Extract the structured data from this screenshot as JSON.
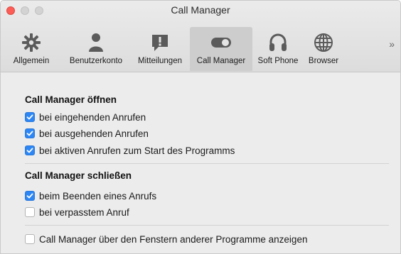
{
  "window": {
    "title": "Call Manager"
  },
  "toolbar": {
    "tabs": [
      {
        "label": "Allgemein",
        "icon": "gear-icon"
      },
      {
        "label": "Benutzerkonto",
        "icon": "user-icon"
      },
      {
        "label": "Mitteilungen",
        "icon": "notification-icon"
      },
      {
        "label": "Call Manager",
        "icon": "toggle-icon",
        "active": true
      },
      {
        "label": "Soft Phone",
        "icon": "headset-icon"
      },
      {
        "label": "Browser",
        "icon": "globe-icon"
      }
    ],
    "more_label": "»"
  },
  "open_section": {
    "title": "Call Manager öffnen",
    "options": [
      {
        "label": "bei eingehenden Anrufen",
        "checked": true
      },
      {
        "label": "bei ausgehenden Anrufen",
        "checked": true
      },
      {
        "label": "bei aktiven Anrufen zum Start des Programms",
        "checked": true
      }
    ]
  },
  "close_section": {
    "title": "Call Manager schließen",
    "options": [
      {
        "label": "beim Beenden eines Anrufs",
        "checked": true
      },
      {
        "label": "bei verpasstem Anruf",
        "checked": false
      }
    ]
  },
  "extra_option": {
    "label": "Call Manager über den Fenstern anderer Programme anzeigen",
    "checked": false
  },
  "colors": {
    "accent": "#2d86f3",
    "close_button": "#fc5e57"
  }
}
